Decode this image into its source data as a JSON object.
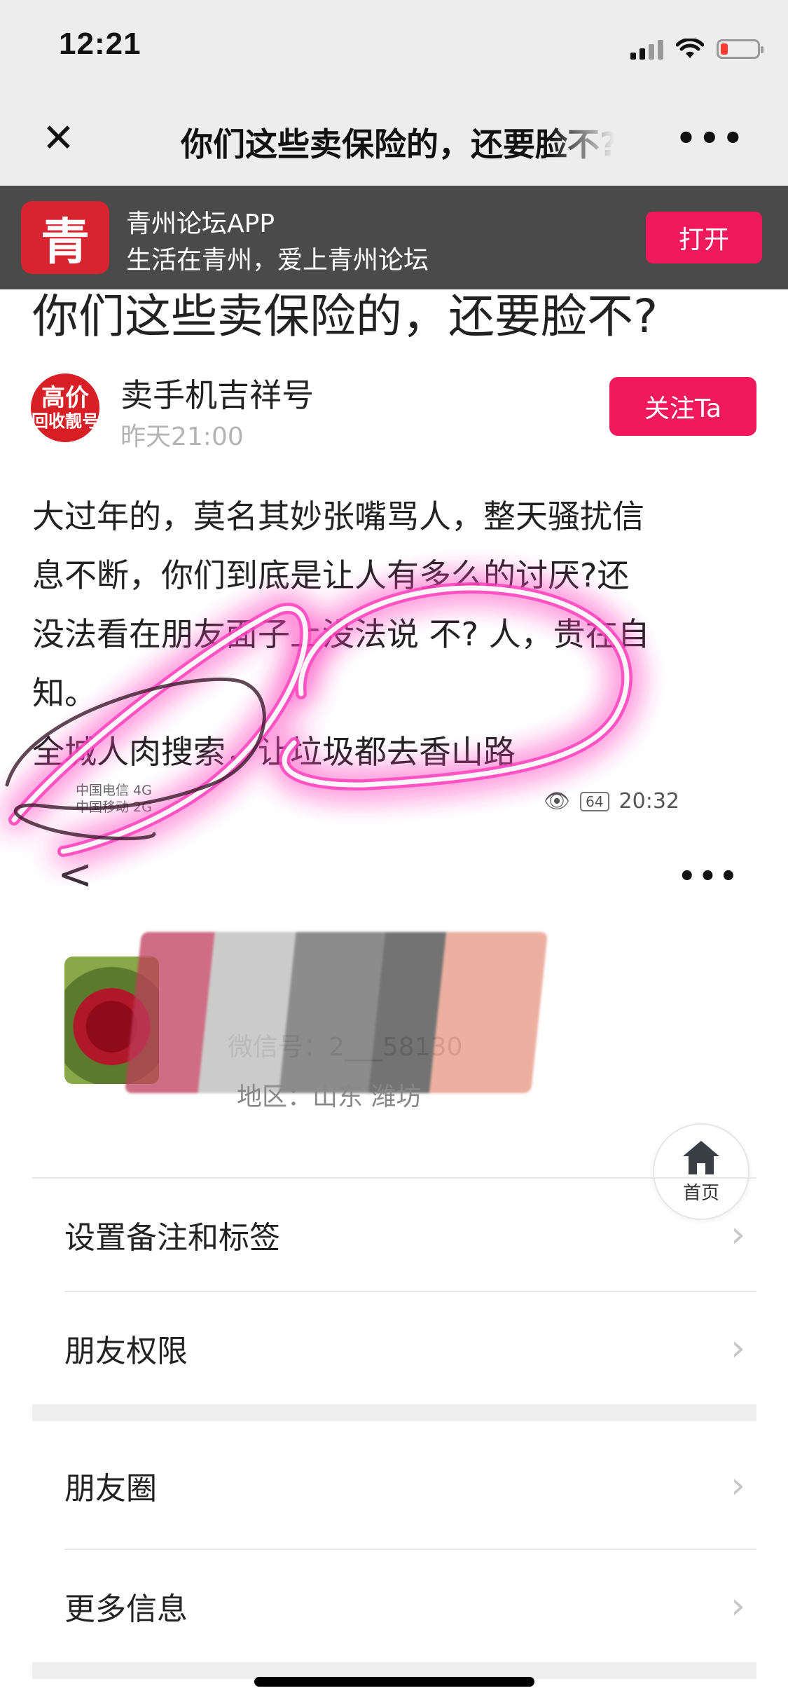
{
  "status_bar": {
    "time": "12:21"
  },
  "nav": {
    "close_icon": "close-icon",
    "title": "你们这些卖保险的，还要脸不?",
    "more": "•••"
  },
  "app_banner": {
    "logo_glyph": "青",
    "name": "青州论坛APP",
    "slogan": "生活在青州，爱上青州论坛",
    "open_label": "打开"
  },
  "article": {
    "title": "你们这些卖保险的，还要脸不?",
    "author": {
      "avatar_text_1": "高价",
      "avatar_text_2": "回收靓号",
      "name": "卖手机吉祥号",
      "time": "昨天21:00"
    },
    "follow_label": "关注Ta",
    "body_lines": [
      "大过年的，莫名其妙张嘴骂人，整天骚扰信",
      "息不断，你们到底是让人有多么的讨厌?还",
      "没法看在朋友面子上没法说 不? 人，贵在自",
      "知。",
      "全城人肉搜索，让垃圾都去香山路"
    ]
  },
  "embedded": {
    "carrier_1": "中国电信 4G",
    "carrier_2": "中国移动 2G",
    "battery": "64",
    "time": "20:32",
    "back": "<",
    "more": "•••",
    "wechat_id": "微信号：2___58130",
    "region": "地区：山东  潍坊"
  },
  "home_fab": {
    "label": "首页"
  },
  "menu": {
    "group1": [
      "设置备注和标签",
      "朋友权限"
    ],
    "group2": [
      "朋友圈",
      "更多信息"
    ],
    "chevron": "›"
  },
  "colors": {
    "accent": "#f0195c",
    "banner_bg": "#4a4a4a",
    "nav_bg": "#ededed",
    "markup_pink": "#ff4fc3"
  }
}
